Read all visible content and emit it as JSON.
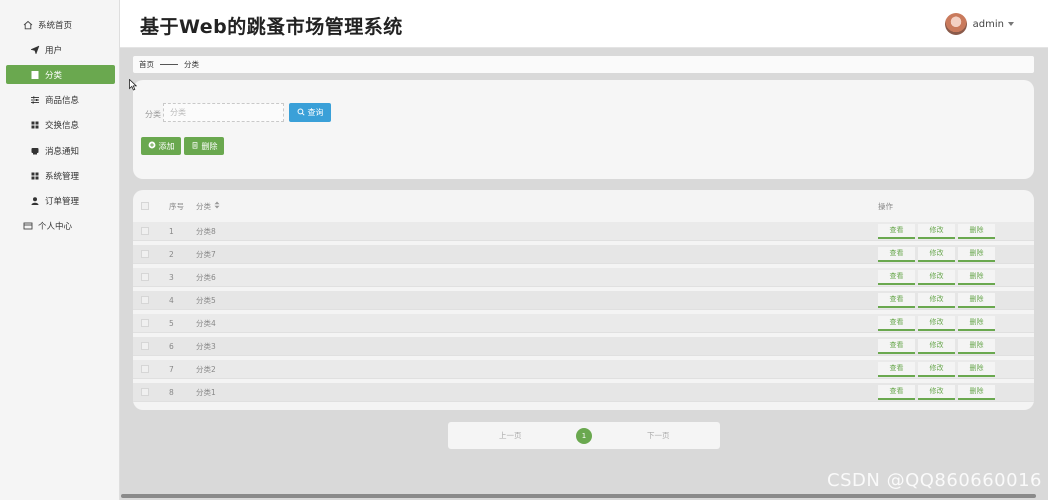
{
  "app": {
    "title": "基于Web的跳蚤市场管理系统",
    "user_name": "admin"
  },
  "sidebar": {
    "items": [
      {
        "label": "系统首页",
        "icon": "home-icon"
      },
      {
        "label": "用户",
        "icon": "send-icon"
      },
      {
        "label": "分类",
        "icon": "document-icon",
        "active": true
      },
      {
        "label": "商品信息",
        "icon": "sliders-icon"
      },
      {
        "label": "交换信息",
        "icon": "grid-icon"
      },
      {
        "label": "消息通知",
        "icon": "inbox-icon"
      },
      {
        "label": "系统管理",
        "icon": "grid-icon"
      },
      {
        "label": "订单管理",
        "icon": "person-icon"
      },
      {
        "label": "个人中心",
        "icon": "card-icon"
      }
    ]
  },
  "breadcrumb": {
    "home": "首页",
    "current": "分类"
  },
  "search": {
    "label": "分类",
    "placeholder": "分类",
    "value": "",
    "query_button": "查询"
  },
  "toolbar": {
    "add_label": "添加",
    "delete_label": "删除"
  },
  "table": {
    "headers": {
      "index": "序号",
      "category": "分类",
      "actions": "操作"
    },
    "rows": [
      {
        "index": "1",
        "category": "分类8"
      },
      {
        "index": "2",
        "category": "分类7"
      },
      {
        "index": "3",
        "category": "分类6"
      },
      {
        "index": "4",
        "category": "分类5"
      },
      {
        "index": "5",
        "category": "分类4"
      },
      {
        "index": "6",
        "category": "分类3"
      },
      {
        "index": "7",
        "category": "分类2"
      },
      {
        "index": "8",
        "category": "分类1"
      }
    ],
    "row_actions": {
      "view": "查看",
      "edit": "修改",
      "delete": "删除"
    }
  },
  "pagination": {
    "prev": "上一页",
    "current": "1",
    "next": "下一页"
  },
  "watermark": "CSDN @QQ860660016",
  "colors": {
    "accent_green": "#6aa84f",
    "query_blue": "#3aa0d8"
  }
}
